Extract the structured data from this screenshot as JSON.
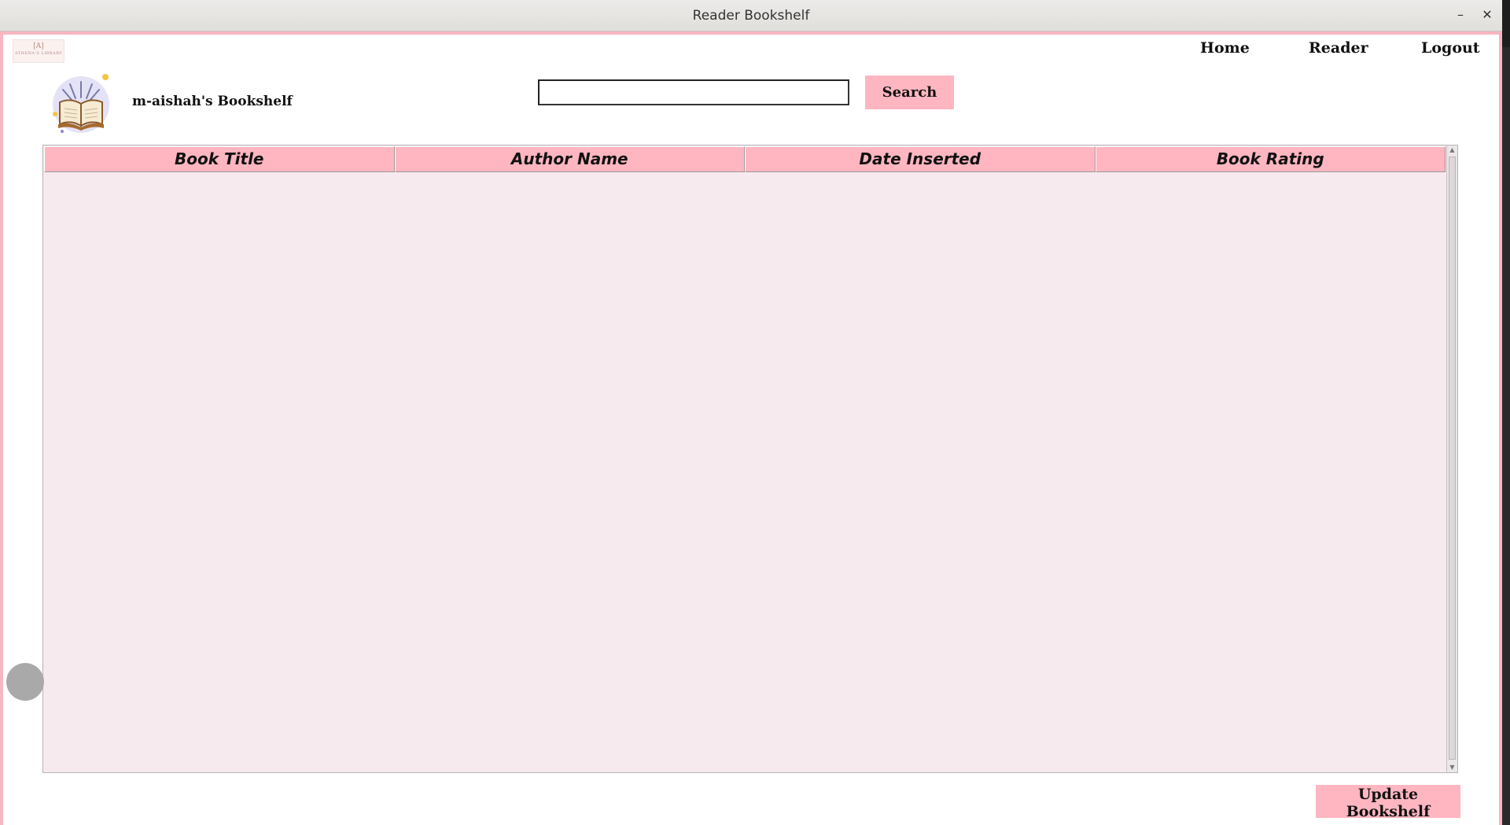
{
  "window": {
    "title": "Reader Bookshelf",
    "minimize_label": "–",
    "close_label": "✕"
  },
  "logo": {
    "mark": "[A]",
    "name": "ATHENA'S LIBRARY"
  },
  "nav": {
    "home": "Home",
    "reader": "Reader",
    "logout": "Logout"
  },
  "profile": {
    "shelf_title": "m-aishah's Bookshelf",
    "avatar_icon": "open-book-icon"
  },
  "search": {
    "value": "",
    "placeholder": "",
    "button_label": "Search"
  },
  "table": {
    "columns": [
      "Book Title",
      "Author Name",
      "Date Inserted",
      "Book Rating"
    ],
    "rows": []
  },
  "actions": {
    "update_label": "Update Bookshelf"
  },
  "colors": {
    "accent": "#ffb6c1",
    "table_bg": "#f7eaee",
    "stripe": "#f7b6c1"
  }
}
